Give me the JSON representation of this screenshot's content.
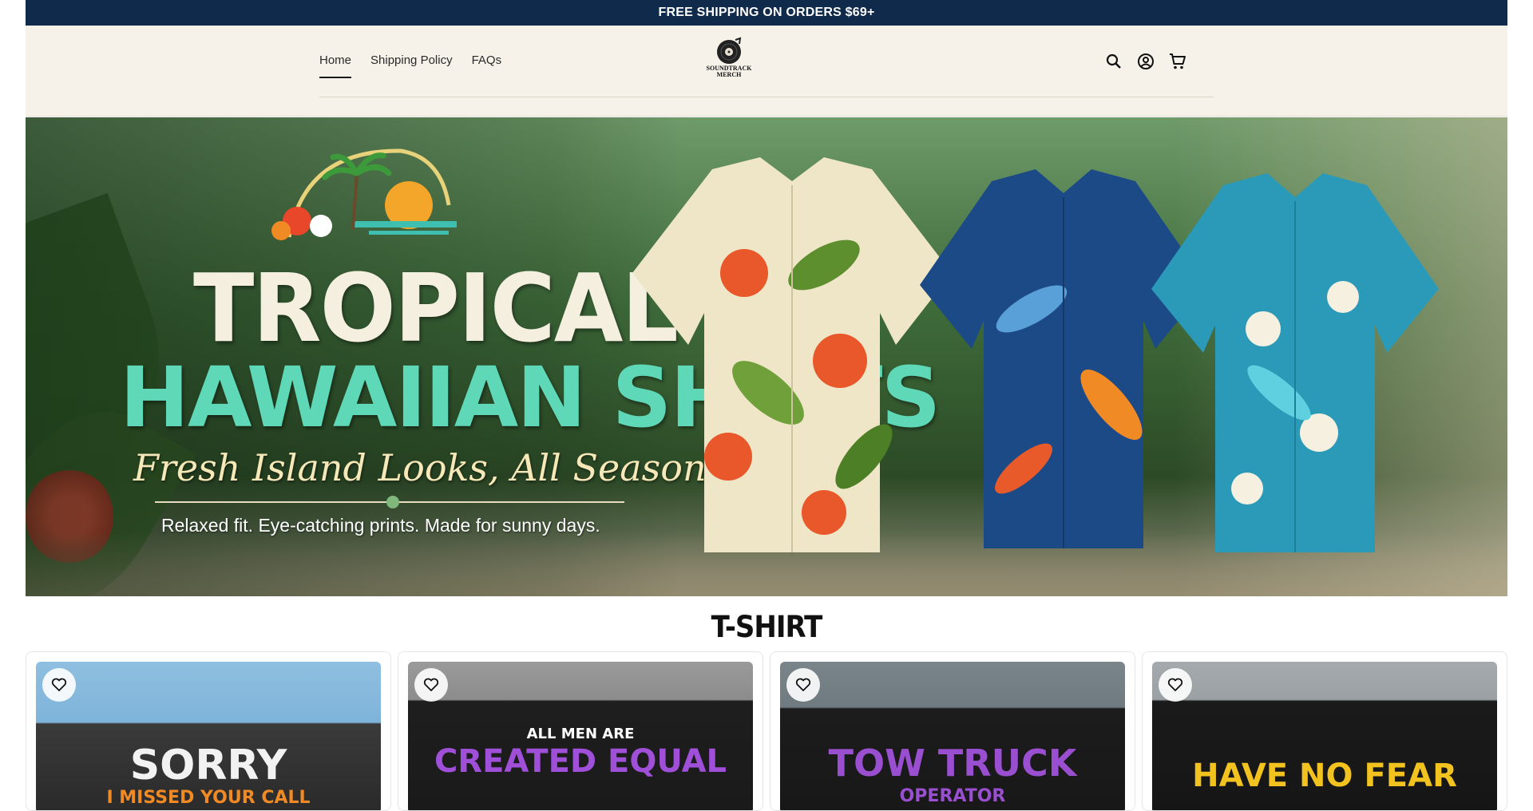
{
  "announcement": {
    "text": "FREE SHIPPING ON ORDERS $69+"
  },
  "nav": {
    "items": [
      {
        "label": "Home",
        "active": true
      },
      {
        "label": "Shipping Policy",
        "active": false
      },
      {
        "label": "FAQs",
        "active": false
      }
    ]
  },
  "logo": {
    "line1": "SOUNDTRACK",
    "line2": "MERCH"
  },
  "header_icons": [
    "search-icon",
    "account-icon",
    "cart-icon"
  ],
  "hero": {
    "title_line1": "TROPICAL",
    "title_line2": "HAWAIIAN SHIRTS",
    "script": "Fresh Island Looks, All Season Long",
    "subtitle": "Relaxed fit. Eye-catching prints. Made for sunny days."
  },
  "section": {
    "title": "T-SHIRT"
  },
  "products": [
    {
      "print_line1": "SORRY",
      "print_line2": "I MISSED YOUR CALL",
      "print_color": "#f2f2f2",
      "accent": "#f08a24",
      "bg": "#7eb3d9"
    },
    {
      "print_line1": "ALL MEN ARE",
      "print_line2": "CREATED EQUAL",
      "print_color": "#ffffff",
      "accent": "#a04fd8",
      "bg": "#8c8c8c"
    },
    {
      "print_line1": "TOW TRUCK",
      "print_line2": "OPERATOR",
      "print_color": "#9a4fd0",
      "accent": "#9a4fd0",
      "bg": "#6f7a80"
    },
    {
      "print_line1": "HAVE NO FEAR",
      "print_line2": "",
      "print_color": "#f2c21f",
      "accent": "#f2c21f",
      "bg": "#9aa0a3"
    }
  ],
  "colors": {
    "announcement_bg": "#0f2a4a",
    "header_bg": "#f6f2ea",
    "accent_green": "#5fd8b8"
  }
}
